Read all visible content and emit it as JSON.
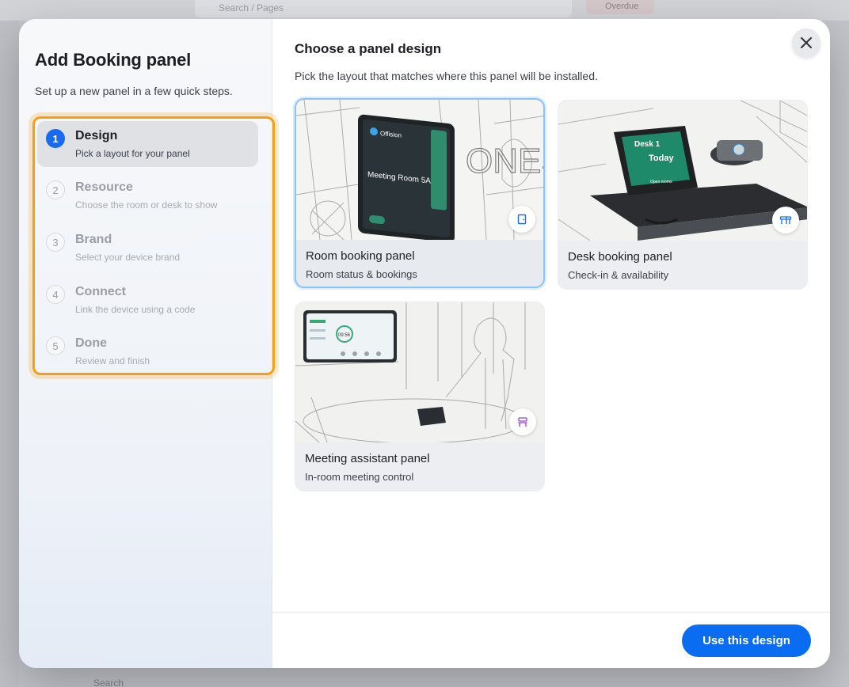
{
  "background": {
    "search_placeholder": "Search / Pages",
    "top_button_label": "Overdue",
    "bottom_text": "Search"
  },
  "modal": {
    "title": "Add Booking panel",
    "subtitle": "Set up a new panel in a few quick steps.",
    "steps": [
      {
        "number": "1",
        "label": "Design",
        "desc": "Pick a layout for your panel",
        "active": true
      },
      {
        "number": "2",
        "label": "Resource",
        "desc": "Choose the room or desk to show",
        "active": false
      },
      {
        "number": "3",
        "label": "Brand",
        "desc": "Select your device brand",
        "active": false
      },
      {
        "number": "4",
        "label": "Connect",
        "desc": "Link the device using a code",
        "active": false
      },
      {
        "number": "5",
        "label": "Done",
        "desc": "Review and finish",
        "active": false
      }
    ],
    "right": {
      "title": "Choose a panel design",
      "subtitle": "Pick the layout that matches where this panel will be installed.",
      "cards": [
        {
          "name": "Room booking panel",
          "desc": "Room status & bookings",
          "selected": true,
          "icon": "door-icon",
          "screen_text": "Meeting Room 5A",
          "brand": "Offision",
          "wall_text": "ONES"
        },
        {
          "name": "Desk booking panel",
          "desc": "Check-in & availability",
          "selected": false,
          "icon": "desk-icon",
          "screen_title": "Desk 1",
          "screen_sub": "Today",
          "screen_button": "Open rooms"
        },
        {
          "name": "Meeting assistant panel",
          "desc": "In-room meeting control",
          "selected": false,
          "icon": "chair-icon",
          "screen_time": "09:56"
        }
      ]
    },
    "footer": {
      "primary_label": "Use this design"
    },
    "colors": {
      "accent": "#0a6cf0",
      "step_active": "#1a6af0",
      "highlight": "#f59f15",
      "selected_border": "#8ec4f5"
    }
  }
}
